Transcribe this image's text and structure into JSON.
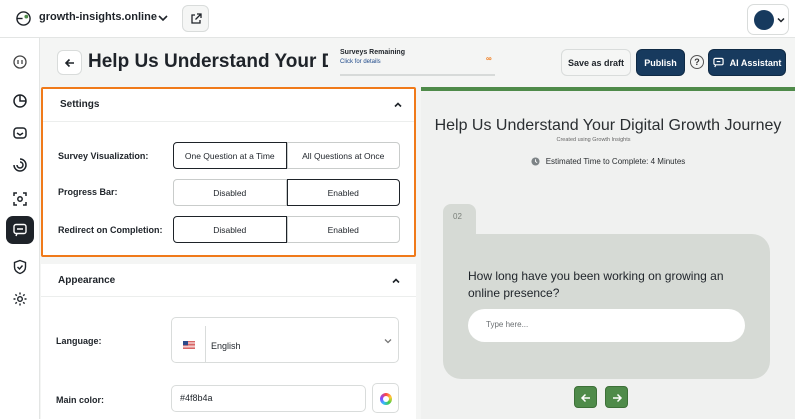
{
  "topbar": {
    "site_name": "growth-insights.online",
    "icons": [
      "site-logo-icon",
      "chevron-down-icon",
      "external-link-icon",
      "avatar",
      "chevron-down-icon"
    ]
  },
  "rail": {
    "icons": [
      "history-icon",
      "analytics-icon",
      "inbox-icon",
      "funnel-icon",
      "scan-icon",
      "survey-icon",
      "shield-icon",
      "gear-icon"
    ],
    "active": "survey-icon"
  },
  "header": {
    "title": "Help Us Understand Your Digit",
    "surveys_remaining_label": "Surveys Remaining",
    "click_details": "Click for details",
    "surveys_count": "∞",
    "save_draft": "Save as draft",
    "publish": "Publish",
    "help": "?",
    "ai_assistant": "AI Assistant"
  },
  "settings": {
    "heading": "Settings",
    "rows": [
      {
        "label": "Survey Visualization:",
        "options": [
          "One Question at a Time",
          "All Questions at Once"
        ],
        "selected": 0
      },
      {
        "label": "Progress Bar:",
        "options": [
          "Disabled",
          "Enabled"
        ],
        "selected": 1
      },
      {
        "label": "Redirect on Completion:",
        "options": [
          "Disabled",
          "Enabled"
        ],
        "selected": 0
      }
    ]
  },
  "appearance": {
    "heading": "Appearance",
    "language_label": "Language:",
    "language_value": "English",
    "main_color_label": "Main color:",
    "main_color_value": "#4f8b4a"
  },
  "preview": {
    "title": "Help Us Understand Your Digital Growth Journey",
    "subtitle": "Created using Growth Insights",
    "time": "Estimated Time to Complete: 4 Minutes",
    "question_number": "02",
    "question": "How long have you been working on growing an online presence?",
    "input_placeholder": "Type here...",
    "progress_fraction": 1.0
  },
  "colors": {
    "accent": "#4f8b4a",
    "navy": "#173a5e",
    "highlight": "#f07a1a"
  }
}
